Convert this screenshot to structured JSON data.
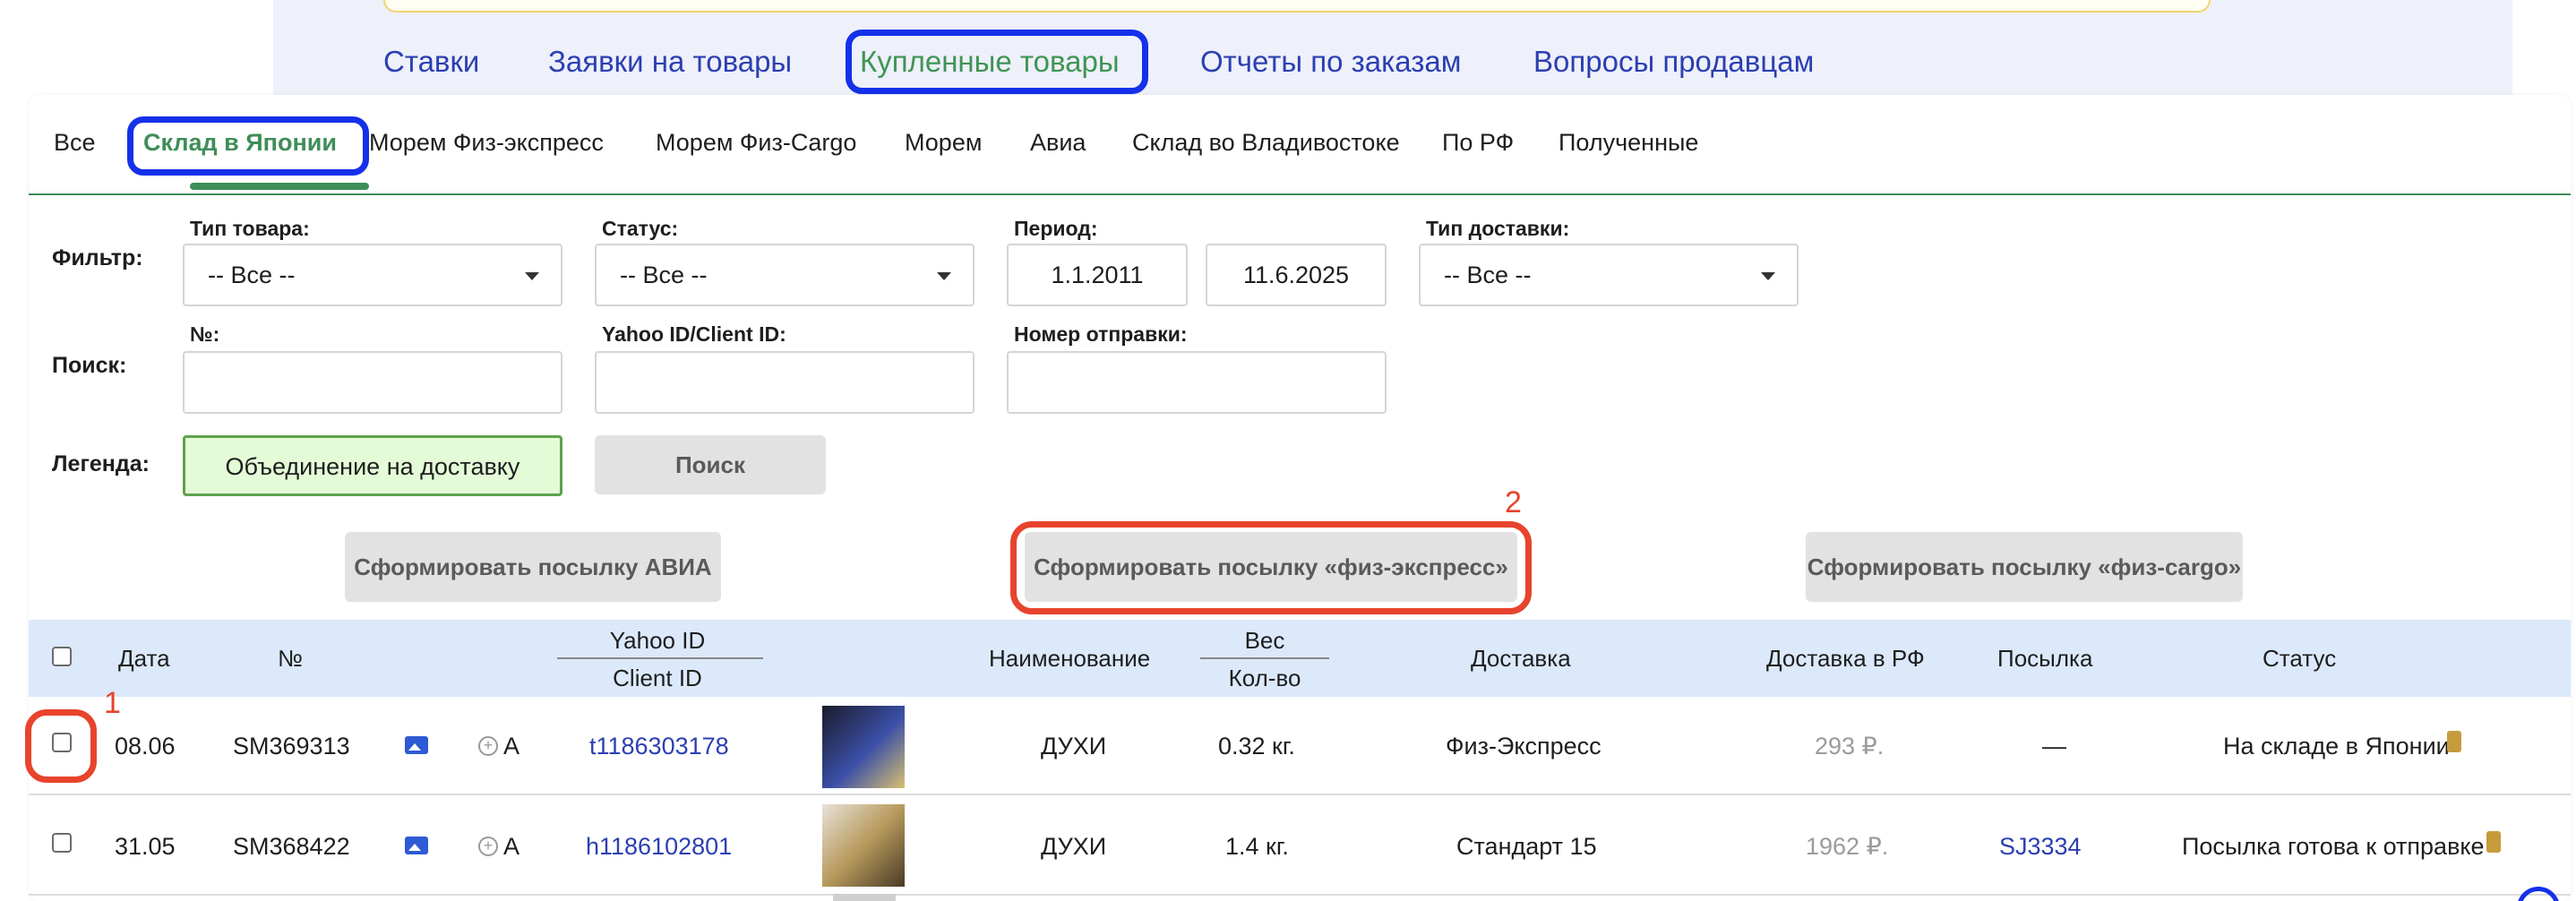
{
  "nav": {
    "items": [
      {
        "label": "Ставки"
      },
      {
        "label": "Заявки на товары"
      },
      {
        "label": "Купленные товары"
      },
      {
        "label": "Отчеты по заказам"
      },
      {
        "label": "Вопросы продавцам"
      }
    ],
    "active_color": "#3f9554",
    "link_color": "#2c3fb1"
  },
  "subtabs": [
    {
      "label": "Все"
    },
    {
      "label": "Склад в Японии"
    },
    {
      "label": "Морем Физ-экспресс"
    },
    {
      "label": "Морем Физ-Cargo"
    },
    {
      "label": "Морем"
    },
    {
      "label": "Авиа"
    },
    {
      "label": "Склад во Владивостоке"
    },
    {
      "label": "По РФ"
    },
    {
      "label": "Полученные"
    }
  ],
  "filter": {
    "label": "Фильтр:",
    "product_type": {
      "label": "Тип товара:",
      "value": "-- Все --"
    },
    "status": {
      "label": "Статус:",
      "value": "-- Все --"
    },
    "period": {
      "label": "Период:",
      "from": "1.1.2011",
      "to": "11.6.2025"
    },
    "delivery_type": {
      "label": "Тип доставки:",
      "value": "-- Все --"
    }
  },
  "search": {
    "label": "Поиск:",
    "number_label": "№:",
    "yahoo_label": "Yahoo ID/Client ID:",
    "shipment_label": "Номер отправки:",
    "button": "Поиск"
  },
  "legend": {
    "label": "Легенда:",
    "merge": "Объединение на доставку",
    "merge_color": "#e4fbd7"
  },
  "actions": {
    "avia": "Сформировать посылку АВИА",
    "fiz_express": "Сформировать посылку «физ-экспресс»",
    "fiz_cargo": "Сформировать посылку «физ-cargo»"
  },
  "annotations": {
    "marker1": "1",
    "marker2": "2",
    "color": "#e8432d",
    "highlight_color": "#1430ea"
  },
  "table": {
    "headers": {
      "date": "Дата",
      "number": "№",
      "yahoo_id": "Yahoo ID",
      "client_id": "Client ID",
      "name": "Наименование",
      "weight": "Вес",
      "qty": "Кол-во",
      "delivery": "Доставка",
      "delivery_rf": "Доставка в РФ",
      "parcel": "Посылка",
      "status": "Статус"
    },
    "rows": [
      {
        "date": "08.06",
        "number": "SM369313",
        "flag": "A",
        "yahoo_id": "t1186303178",
        "name": "ДУХИ",
        "weight": "0.32 кг.",
        "delivery": "Физ-Экспресс",
        "delivery_rf": "293 ₽.",
        "parcel": "—",
        "status": "На складе в Японии"
      },
      {
        "date": "31.05",
        "number": "SM368422",
        "flag": "A",
        "yahoo_id": "h1186102801",
        "name": "ДУХИ",
        "weight": "1.4 кг.",
        "delivery": "Стандарт 15",
        "delivery_rf": "1962 ₽.",
        "parcel": "SJ3334",
        "status": "Посылка готова к отправке"
      }
    ]
  }
}
